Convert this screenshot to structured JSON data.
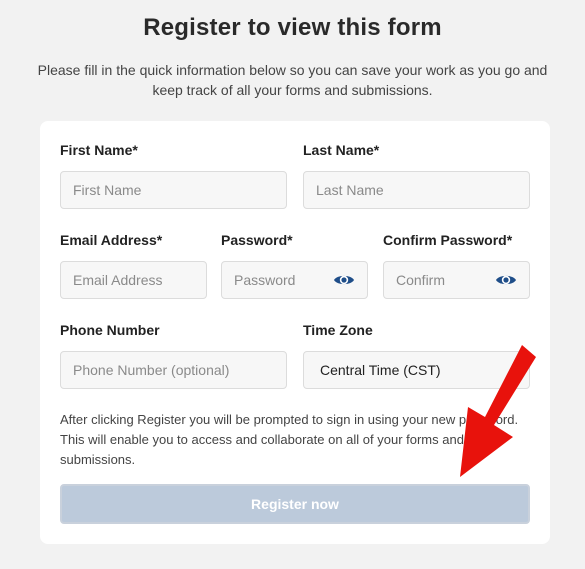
{
  "header": {
    "title": "Register to view this form",
    "subtitle": "Please fill in the quick information below so you can save your work as you go and keep track of all your forms and submissions."
  },
  "form": {
    "first_name": {
      "label": "First Name*",
      "placeholder": "First Name",
      "value": ""
    },
    "last_name": {
      "label": "Last Name*",
      "placeholder": "Last Name",
      "value": ""
    },
    "email": {
      "label": "Email Address*",
      "placeholder": "Email Address",
      "value": ""
    },
    "password": {
      "label": "Password*",
      "placeholder": "Password",
      "value": ""
    },
    "confirm_password": {
      "label": "Confirm Password*",
      "placeholder": "Confirm",
      "value": ""
    },
    "phone": {
      "label": "Phone Number",
      "placeholder": "Phone Number (optional)",
      "value": ""
    },
    "time_zone": {
      "label": "Time Zone",
      "selected": "Central Time (CST)"
    },
    "note": "After clicking Register you will be prompted to sign in using your new password. This will enable you to access and collaborate on all of your forms and submissions.",
    "submit_label": "Register now",
    "submit_enabled": false
  },
  "icons": {
    "password_toggle": "eye-icon",
    "confirm_toggle": "eye-icon"
  },
  "colors": {
    "eye_icon": "#1f4e89",
    "button_disabled": "#bccadb",
    "annotation_arrow": "#e8120c"
  }
}
